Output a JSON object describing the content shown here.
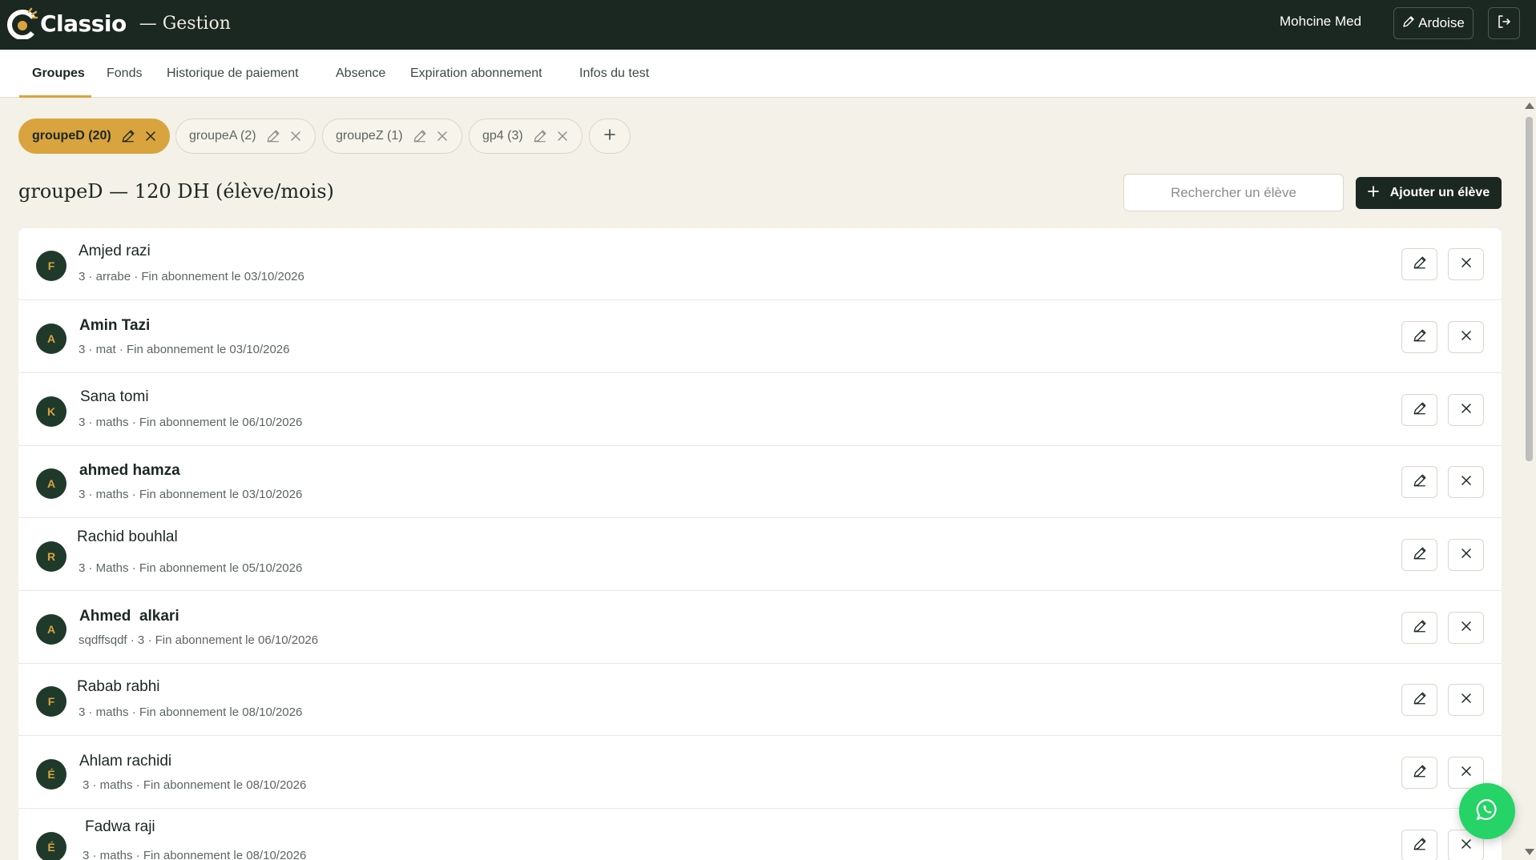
{
  "app": {
    "brand": "Classio",
    "section": "— Gestion"
  },
  "header": {
    "user_name": "Mohcine Med",
    "ardoise_label": "Ardoise"
  },
  "tabs": [
    {
      "label": "Groupes",
      "active": true
    },
    {
      "label": "Fonds"
    },
    {
      "label": "Historique de paiement"
    },
    {
      "label": "Absence"
    },
    {
      "label": "Expiration abonnement"
    },
    {
      "label": "Infos du test"
    }
  ],
  "groups": [
    {
      "label": "groupeD (20)",
      "active": true
    },
    {
      "label": "groupeA (2)"
    },
    {
      "label": "groupeZ (1)"
    },
    {
      "label": "gp4 (3)"
    }
  ],
  "current_group": {
    "title": "groupeD — 120 DH (élève/mois)"
  },
  "search": {
    "placeholder": "Rechercher un élève"
  },
  "add_student_label": "Ajouter un élève",
  "students": [
    {
      "initial": "F",
      "name": "Amjed razi",
      "meta": "3 · arrabe · Fin abonnement le 03/10/2026"
    },
    {
      "initial": "A",
      "name": "Amin Tazi",
      "meta": "3 · mat · Fin abonnement le 03/10/2026"
    },
    {
      "initial": "K",
      "name": "Sana tomi",
      "meta": "3 · maths · Fin abonnement le 06/10/2026"
    },
    {
      "initial": "A",
      "name": "ahmed hamza",
      "meta": "3 · maths · Fin abonnement le 03/10/2026"
    },
    {
      "initial": "R",
      "name": "Rachid bouhlal",
      "meta": "3 · Maths · Fin abonnement le 05/10/2026"
    },
    {
      "initial": "A",
      "name": "Ahmed  alkari",
      "meta": "sqdffsqdf · 3 · Fin abonnement le 06/10/2026"
    },
    {
      "initial": "F",
      "name": "Rabab rabhi",
      "meta": "3 · maths · Fin abonnement le 08/10/2026"
    },
    {
      "initial": "É",
      "name": "Ahlam rachidi",
      "meta": "3 · maths · Fin abonnement le 08/10/2026"
    },
    {
      "initial": "É",
      "name": "Fadwa raji",
      "meta": "3 · maths · Fin abonnement le 08/10/2026"
    }
  ],
  "colors": {
    "header_bg": "#1b2721",
    "accent": "#d9a43d",
    "page_bg": "#f4f1e9",
    "whatsapp": "#25d366"
  }
}
